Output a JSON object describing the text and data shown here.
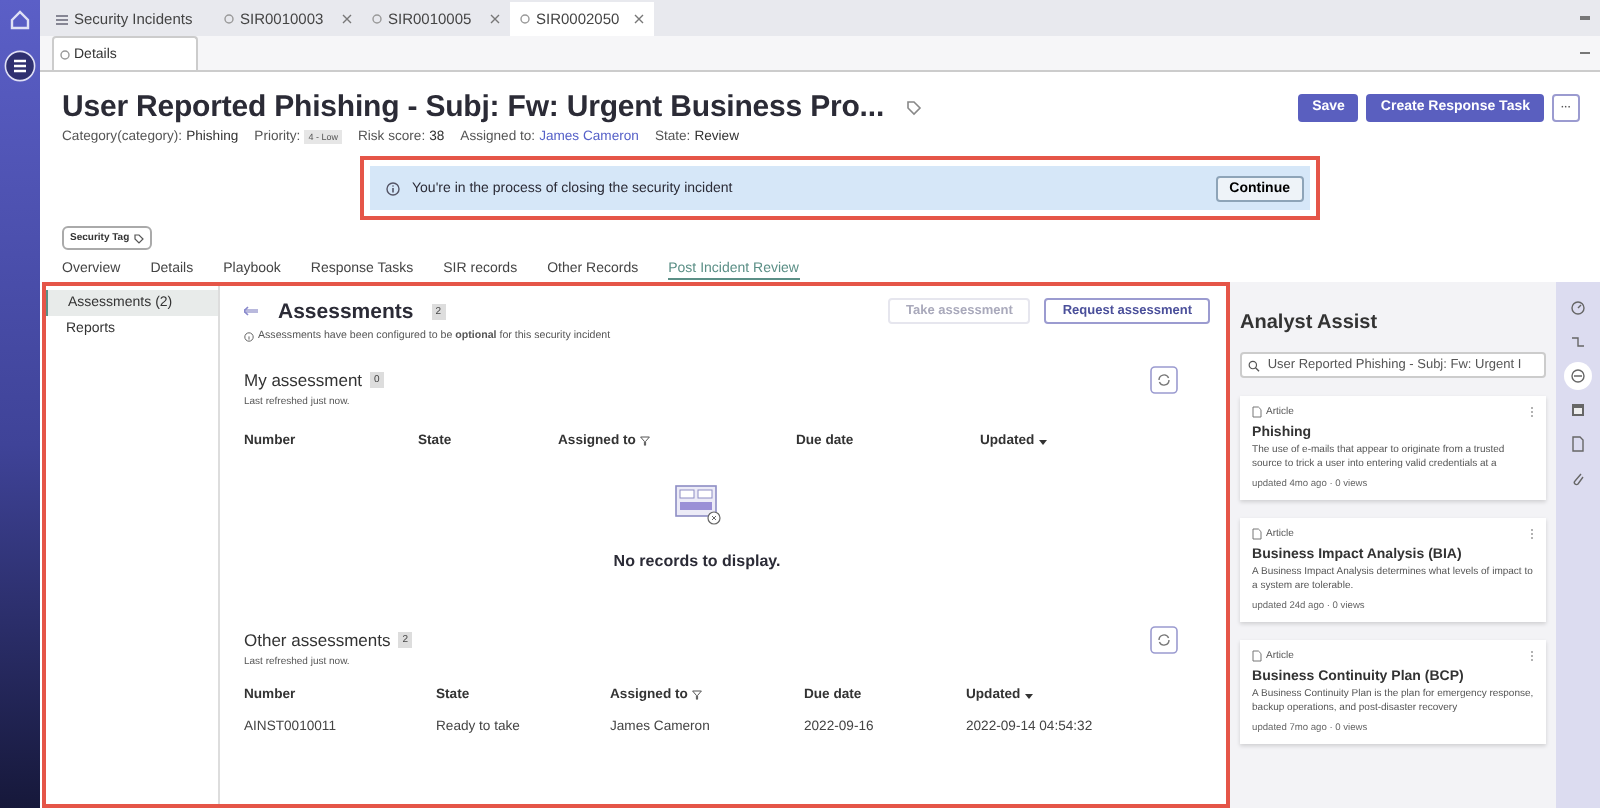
{
  "window_tabs": [
    {
      "label": "Security Incidents",
      "kind": "list",
      "selected": false
    },
    {
      "label": "SIR0010003",
      "kind": "record",
      "selected": false
    },
    {
      "label": "SIR0010005",
      "kind": "record",
      "selected": false
    },
    {
      "label": "SIR0002050",
      "kind": "record",
      "selected": true
    }
  ],
  "sub_tabs": [
    {
      "label": "Details",
      "selected": true
    }
  ],
  "record": {
    "title": "User Reported Phishing - Subj: Fw: Urgent Business Pro...",
    "meta": [
      {
        "label": "Category(category):",
        "value": "Phishing",
        "kind": "text"
      },
      {
        "label": "Priority:",
        "value": "4 - Low",
        "kind": "badge"
      },
      {
        "label": "Risk score:",
        "value": "38",
        "kind": "text"
      },
      {
        "label": "Assigned to:",
        "value": "James Cameron",
        "kind": "link"
      },
      {
        "label": "State:",
        "value": "Review",
        "kind": "text"
      }
    ],
    "actions": [
      {
        "label": "Save",
        "kind": "primary"
      },
      {
        "label": "Create Response Task",
        "kind": "primary"
      },
      {
        "label": "···",
        "kind": "more"
      }
    ]
  },
  "banner": {
    "message": "You're in the process of closing the security incident",
    "button": "Continue",
    "highlighted": true
  },
  "tag": "Security Tag",
  "section_tabs": [
    {
      "label": "Overview",
      "selected": false
    },
    {
      "label": "Details",
      "selected": false
    },
    {
      "label": "Playbook",
      "selected": false
    },
    {
      "label": "Response Tasks",
      "selected": false
    },
    {
      "label": "SIR records",
      "selected": false
    },
    {
      "label": "Other Records",
      "selected": false
    },
    {
      "label": "Post Incident Review",
      "selected": true
    }
  ],
  "panel": {
    "highlighted": true,
    "nav": [
      {
        "label": "Assessments (2)",
        "selected": true
      },
      {
        "label": "Reports",
        "selected": false
      }
    ],
    "title": "Assessments",
    "count": "2",
    "note": "Assessments have been configured to be **optional** for this security incident",
    "buttons": [
      {
        "label": "Take assessment",
        "disabled": true
      },
      {
        "label": "Request assessment",
        "disabled": false
      }
    ],
    "tables": [
      {
        "title": "My assessment",
        "count": "0",
        "refreshed": "Last refreshed just now.",
        "columns": [
          {
            "label": "Number",
            "kind": "plain"
          },
          {
            "label": "State",
            "kind": "plain"
          },
          {
            "label": "Assigned to",
            "kind": "filter"
          },
          {
            "label": "Due date",
            "kind": "plain"
          },
          {
            "label": "Updated",
            "kind": "sort"
          }
        ],
        "empty_message": "No records to display."
      },
      {
        "title": "Other assessments",
        "count": "2",
        "refreshed": "Last refreshed just now.",
        "columns": [
          {
            "label": "Number",
            "kind": "plain"
          },
          {
            "label": "State",
            "kind": "plain"
          },
          {
            "label": "Assigned to",
            "kind": "filter"
          },
          {
            "label": "Due date",
            "kind": "plain"
          },
          {
            "label": "Updated",
            "kind": "sort"
          }
        ],
        "rows": [
          [
            "AINST0010011",
            "Ready to take",
            "James Cameron",
            "2022-09-16",
            "2022-09-14 04:54:32"
          ]
        ]
      }
    ]
  },
  "analyst_assist": {
    "title": "Analyst Assist",
    "search": "User Reported Phishing - Subj: Fw: Urgent I",
    "articles": [
      {
        "type": "Article",
        "title": "Phishing",
        "summary": "The use of e-mails that appear to originate from a trusted source to trick a user into entering valid credentials at a",
        "meta": "updated 4mo ago · 0 views"
      },
      {
        "type": "Article",
        "title": "Business Impact Analysis (BIA)",
        "summary": "A Business Impact Analysis determines what levels of impact to a system are tolerable.",
        "meta": "updated 24d ago · 0 views"
      },
      {
        "type": "Article",
        "title": "Business Continuity Plan (BCP)",
        "summary": "A Business Continuity Plan is the plan for emergency response, backup operations, and post-disaster recovery",
        "meta": "updated 7mo ago · 0 views"
      }
    ]
  }
}
